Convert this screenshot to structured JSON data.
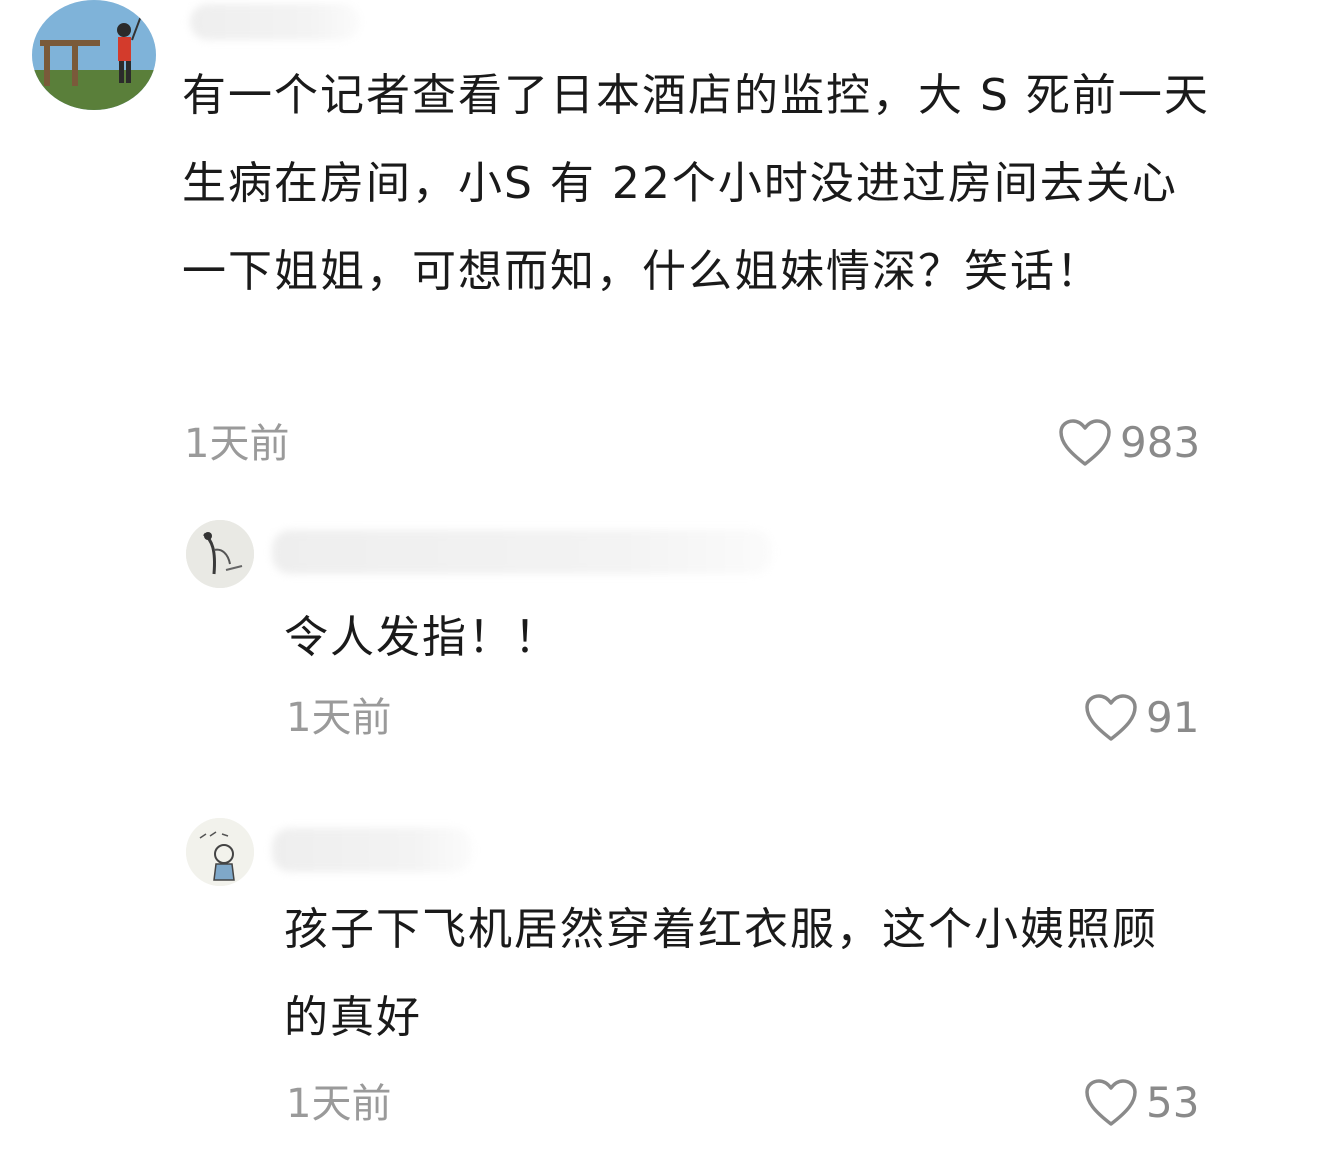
{
  "comments": [
    {
      "text": "有一个记者查看了日本酒店的监控，大 S 死前一天生病在房间，小S 有 22个小时没进过房间去关心一下姐姐，可想而知，什么姐妹情深？笑话！",
      "time": "1天前",
      "likes": "983",
      "avatar_icon": "landscape-avatar"
    },
    {
      "text": "令人发指！！",
      "time": "1天前",
      "likes": "91",
      "avatar_icon": "ink-painting-avatar"
    },
    {
      "text": "孩子下飞机居然穿着红衣服，这个小姨照顾的真好",
      "time": "1天前",
      "likes": "53",
      "avatar_icon": "sketch-girl-avatar"
    }
  ],
  "icons": {
    "like": "heart-outline-icon"
  },
  "colors": {
    "text": "#1a1a1a",
    "meta": "#9a9a9a",
    "background": "#ffffff"
  }
}
